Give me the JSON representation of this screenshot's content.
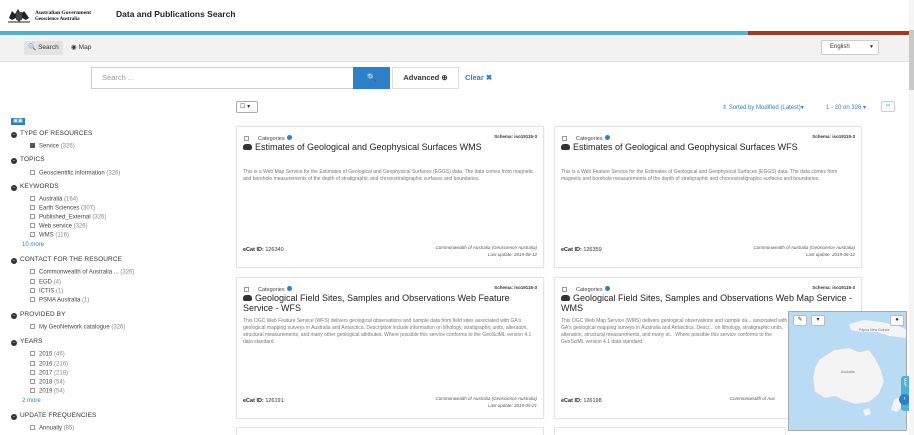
{
  "header": {
    "gov_line1": "Australian Government",
    "gov_line2": "Geoscience Australia",
    "app_title": "Data and Publications Search"
  },
  "nav": {
    "tabs": [
      {
        "label": "Search",
        "icon": "search-icon",
        "active": true
      },
      {
        "label": "Map",
        "icon": "globe-icon",
        "active": false
      }
    ],
    "language": "English"
  },
  "search": {
    "placeholder": "Search ...",
    "advanced_label": "Advanced",
    "clear_label": "Clear ✖"
  },
  "facets": [
    {
      "title": "TYPE OF RESOURCES",
      "items": [
        {
          "label": "Service",
          "count": "(326)",
          "checked": true
        }
      ]
    },
    {
      "title": "TOPICS",
      "items": [
        {
          "label": "Geoscientific information",
          "count": "(326)"
        }
      ]
    },
    {
      "title": "KEYWORDS",
      "items": [
        {
          "label": "Australia",
          "count": "(164)"
        },
        {
          "label": "Earth Sciences",
          "count": "(307)"
        },
        {
          "label": "Published_External",
          "count": "(326)"
        },
        {
          "label": "Web service",
          "count": "(326)"
        },
        {
          "label": "WMS",
          "count": "(116)"
        }
      ],
      "more": "10 more"
    },
    {
      "title": "CONTACT FOR THE RESOURCE",
      "items": [
        {
          "label": "Commonwealth of Australia ...",
          "count": "(326)"
        },
        {
          "label": "EGD",
          "count": "(4)"
        },
        {
          "label": "ICTIS",
          "count": "(1)"
        },
        {
          "label": "PSMA Australia",
          "count": "(1)"
        }
      ]
    },
    {
      "title": "PROVIDED BY",
      "items": [
        {
          "label": "My GeoNetwork catalogue",
          "count": "(326)"
        }
      ]
    },
    {
      "title": "YEARS",
      "items": [
        {
          "label": "2015",
          "count": "(46)"
        },
        {
          "label": "2016",
          "count": "(216)"
        },
        {
          "label": "2017",
          "count": "(218)"
        },
        {
          "label": "2018",
          "count": "(54)"
        },
        {
          "label": "2019",
          "count": "(54)"
        }
      ],
      "more": "2 more"
    },
    {
      "title": "UPDATE FREQUENCIES",
      "items": [
        {
          "label": "Annually",
          "count": "(85)"
        }
      ]
    }
  ],
  "results": {
    "sort_label": "⇕ Sorted by Modified (Latest)▾",
    "page_label": "1 - 20 on 326 ▾",
    "cards": [
      {
        "categories": "Categories",
        "schema": "Schema: iso19115-3",
        "title": "Estimates of Geological and Geophysical Surfaces WMS",
        "description": "This is a Web Map Service for the Estimates of Geological and Geophysical Surfaces (EGGS) data. The data comes from magnetic and borehole measurements of the depth of stratigraphic and chronostratigraphic surfaces and boundaries.",
        "ecat_label": "eCat ID:",
        "ecat_id": "126340",
        "org": "Commonwealth of Australia (Geoscience Australia)",
        "updated": "Last update: 2019-06-12"
      },
      {
        "categories": "Categories",
        "schema": "Schema: iso19115-3",
        "title": "Estimates of Geological and Geophysical Surfaces WFS",
        "description": "This is a Web Feature Service for the Estimates of Geological and Geophysical Surfaces (EGGS) data. The data comes from magnetic and borehole measurements of the depth of stratigraphic and chronostratigraphic surfaces and boundaries.",
        "ecat_label": "eCat ID:",
        "ecat_id": "126359",
        "org": "Commonwealth of Australia (Geoscience Australia)",
        "updated": "Last update: 2019-06-12"
      },
      {
        "categories": "Categories",
        "schema": "Schema: iso19115-3",
        "title": "Geological Field Sites, Samples and Observations Web Feature Service - WFS",
        "description": "This OGC Web Feature Service (WFS) delivers geological observations and sample data from field sites associated with GA's geological mapping surveys in Australia and Antarctica. Description include information on lithology, stratigraphic units, alteration, structural measurements, and many other geological attributes. Where possible this service conforms to the GeoSciML version 4.1 data standard.",
        "ecat_label": "eCat ID:",
        "ecat_id": "126191",
        "org": "Commonwealth of Australia (Geoscience Australia)",
        "updated": "Last update: 2019-05-21"
      },
      {
        "categories": "Categories",
        "schema": "Schema: iso19115-3",
        "title": "Geological Field Sites, Samples and Observations Web Map Service - WMS",
        "description": "This OGC Web Map Service (WMS) delivers geological observations and sample da... associated with GA's geological mapping surveys in Australia and Antarctica. Descr... on lithology, stratigraphic units, alteration, structural measurements, and many ot... Where possible this service conforms to the GeoSciML version 4.1 data standard.",
        "ecat_label": "eCat ID:",
        "ecat_id": "126198",
        "org": "Commonwealth of Aus",
        "updated": ""
      }
    ]
  },
  "map": {
    "labels": [
      "Papua New Guinea",
      "Australia"
    ],
    "side_tab": "MAP"
  }
}
